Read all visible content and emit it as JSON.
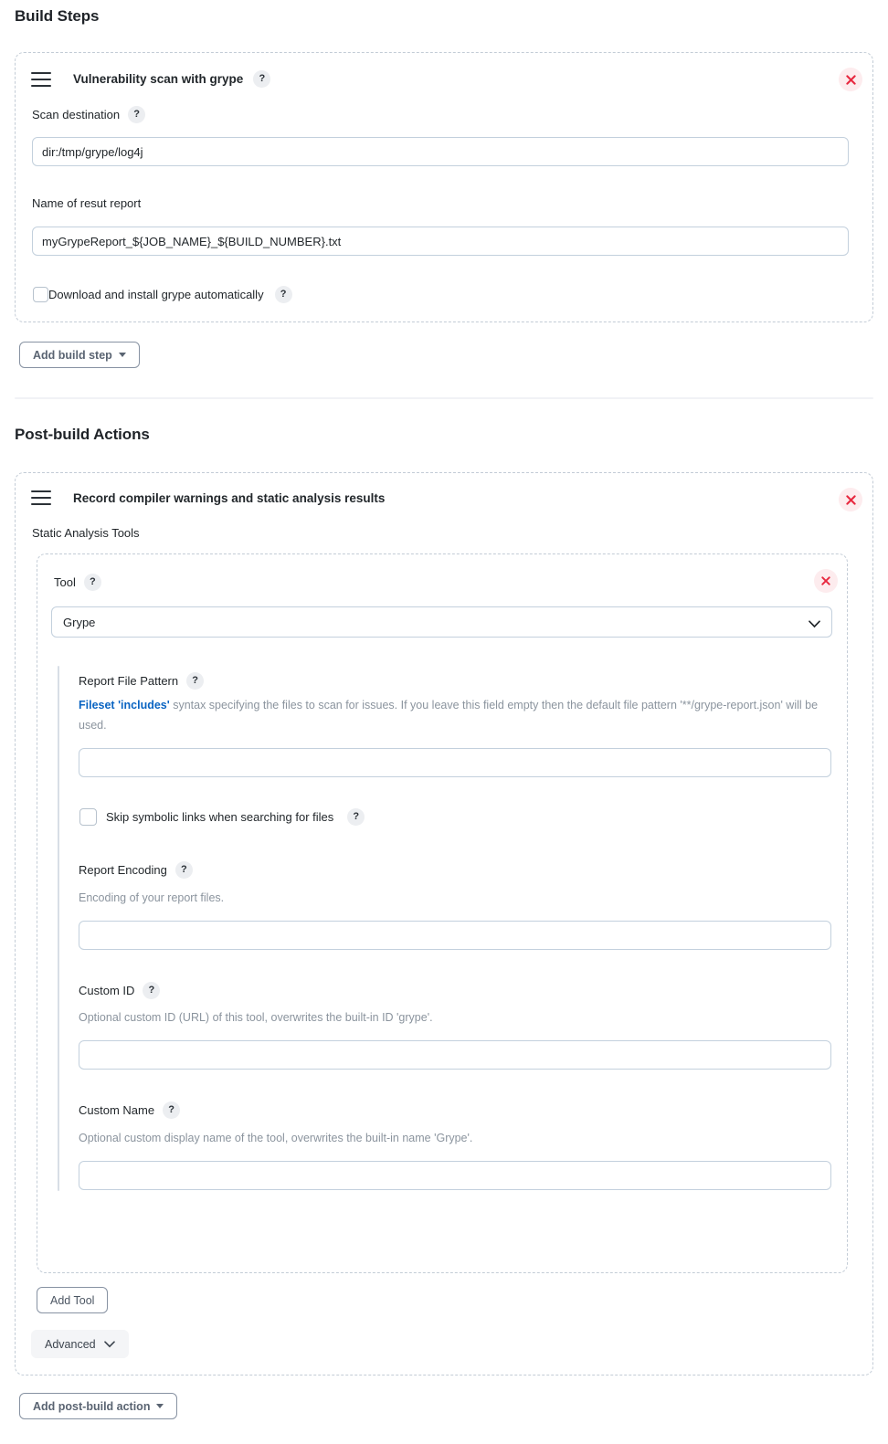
{
  "sections": {
    "build_steps_heading": "Build Steps",
    "post_build_heading": "Post-build Actions"
  },
  "build_step": {
    "title": "Vulnerability scan with grype",
    "title_help": "?",
    "remove_label": "×",
    "scan_destination": {
      "label": "Scan destination",
      "help": "?",
      "value": "dir:/tmp/grype/log4j",
      "placeholder": ""
    },
    "report_name": {
      "label": "Name of resut report",
      "value": "myGrypeReport_${JOB_NAME}_${BUILD_NUMBER}.txt",
      "placeholder": ""
    },
    "auto_install": {
      "label": "Download and install grype automatically",
      "help": "?",
      "checked": false
    },
    "add_build_step_button": "Add build step"
  },
  "post_build": {
    "title": "Record compiler warnings and static analysis results",
    "remove_label": "×",
    "static_analysis_tools_label": "Static Analysis Tools",
    "tool": {
      "label": "Tool",
      "help": "?",
      "remove_label": "×",
      "selected": "Grype",
      "options": [
        "Grype"
      ],
      "report_file_pattern": {
        "label": "Report File Pattern",
        "help": "?",
        "help_link_text": "Fileset 'includes'",
        "help_text_rest": " syntax specifying the files to scan for issues. If you leave this field empty then the default file pattern '**/grype-report.json' will be used.",
        "value": "",
        "placeholder": ""
      },
      "skip_symbolic_links": {
        "label": "Skip symbolic links when searching for files",
        "help": "?",
        "checked": false
      },
      "report_encoding": {
        "label": "Report Encoding",
        "help": "?",
        "help_text": "Encoding of your report files.",
        "value": "",
        "placeholder": ""
      },
      "custom_id": {
        "label": "Custom ID",
        "help": "?",
        "help_text": "Optional custom ID (URL) of this tool, overwrites the built-in ID 'grype'.",
        "value": "",
        "placeholder": ""
      },
      "custom_name": {
        "label": "Custom Name",
        "help": "?",
        "help_text": "Optional custom display name of the tool, overwrites the built-in name 'Grype'.",
        "value": "",
        "placeholder": ""
      }
    },
    "add_tool_button": "Add Tool",
    "advanced_button": "Advanced",
    "add_post_build_action_button": "Add post-build action"
  },
  "colors": {
    "panel_dash": "#c3ccd6",
    "input_border": "#c3d0dd",
    "link": "#0a64c2",
    "help_badge_bg": "#eceef1",
    "remove_bg": "#fdecee",
    "remove_fg": "#e8283f",
    "muted_text": "#8b949e",
    "guide_line": "#d8dee6"
  }
}
